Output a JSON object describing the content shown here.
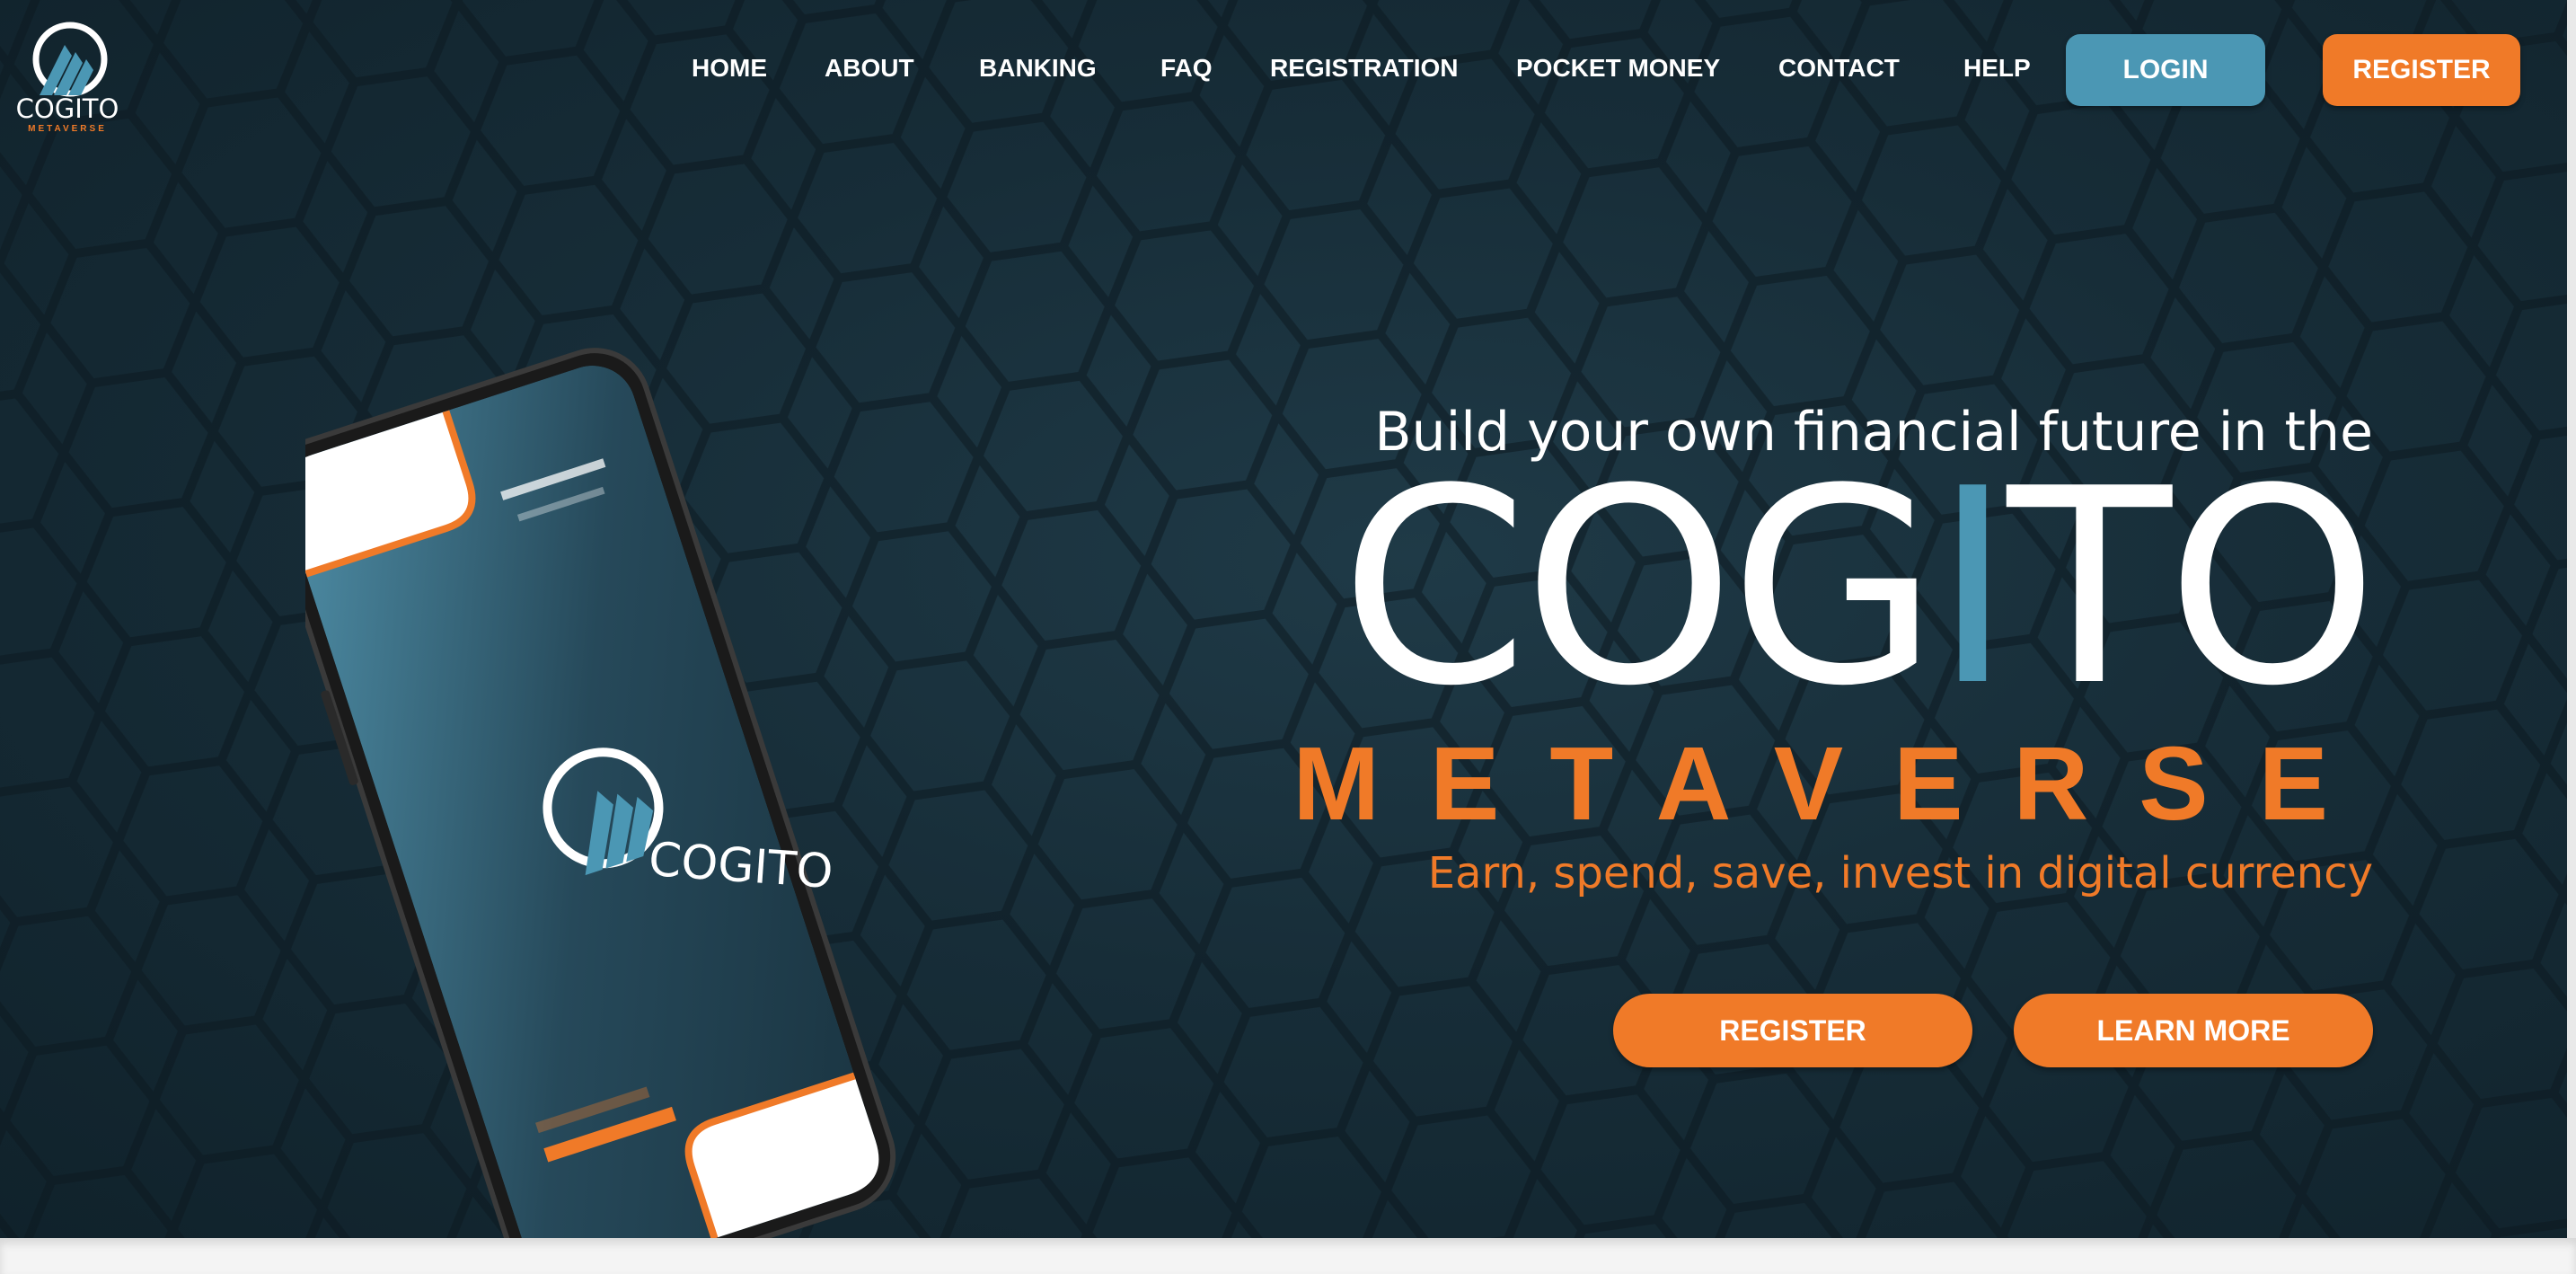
{
  "logo": {
    "word": "COGITO",
    "sub": "METAVERSE"
  },
  "nav": {
    "items": [
      {
        "label": "HOME"
      },
      {
        "label": "ABOUT"
      },
      {
        "label": "BANKING"
      },
      {
        "label": "FAQ"
      },
      {
        "label": "REGISTRATION"
      },
      {
        "label": "POCKET MONEY"
      },
      {
        "label": "CONTACT"
      },
      {
        "label": "HELP"
      }
    ],
    "login_label": "LOGIN",
    "register_label": "REGISTER"
  },
  "hero": {
    "tagline": "Build your own financial future in the",
    "brand_part1": "COG",
    "brand_accent": "I",
    "brand_part2": "TO",
    "metaverse": "METAVERSE",
    "subline": "Earn, spend, save, invest in digital currency",
    "register_label": "REGISTER",
    "learn_more_label": "LEARN MORE"
  },
  "phone": {
    "screen_logo": "COGITO"
  },
  "colors": {
    "accent_orange": "#f07a28",
    "accent_blue": "#4b97b4",
    "background_dark": "#172d38",
    "text_white": "#ffffff"
  },
  "icons": [
    "cogito-logo-icon",
    "phone-mockup"
  ]
}
